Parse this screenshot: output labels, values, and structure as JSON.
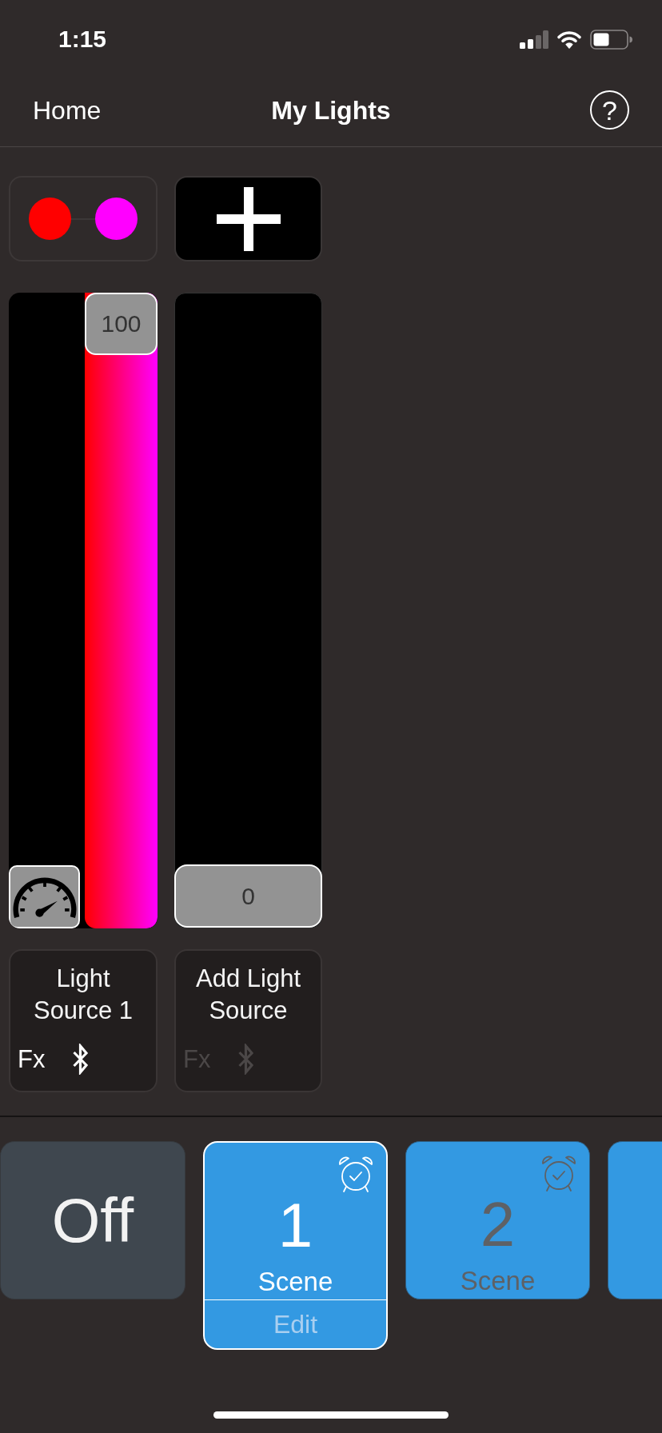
{
  "status_bar": {
    "time": "1:15"
  },
  "nav": {
    "back": "Home",
    "title": "My Lights",
    "help": "?"
  },
  "palette": {
    "swatches": [
      {
        "color": "#ff0000"
      },
      {
        "color": "#ff00ff"
      }
    ]
  },
  "channels": [
    {
      "kind": "gradient",
      "reading": "100",
      "level": 1
    },
    {
      "kind": "plain",
      "reading": "0",
      "level": 0
    }
  ],
  "light_sources": [
    {
      "name": "Light Source 1",
      "fx": "Fx",
      "disabled": false
    },
    {
      "name": "Add Light Source",
      "fx": "Fx",
      "disabled": true
    }
  ],
  "scenes": [
    {
      "kind": "off",
      "label": "Off",
      "selected": false
    },
    {
      "kind": "scene",
      "number": "1",
      "label": "Scene",
      "selected": true,
      "alarm": true,
      "edit": "Edit"
    },
    {
      "kind": "scene",
      "number": "2",
      "label": "Scene",
      "selected": false,
      "alarm": true
    },
    {
      "kind": "scene",
      "selected": false
    }
  ]
}
